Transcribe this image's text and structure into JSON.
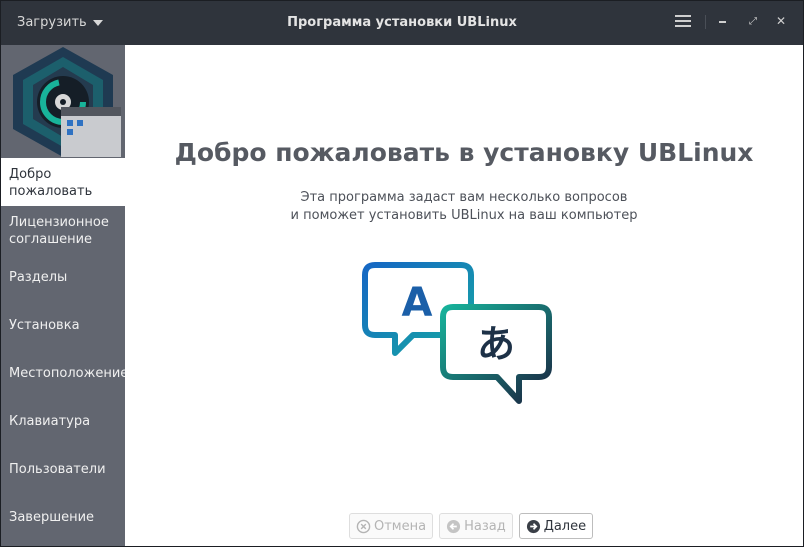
{
  "titlebar": {
    "load_menu": "Загрузить",
    "title": "Программа установки UBLinux",
    "menu_icon": "hamburger-menu-icon",
    "minimize_icon": "minimize-icon",
    "maximize_icon": "maximize-icon",
    "close_icon": "close-icon"
  },
  "sidebar": {
    "logo_icon": "ublinux-installer-logo-icon",
    "items": [
      {
        "label": "Добро пожаловать",
        "active": true
      },
      {
        "label": "Лицензионное соглашение"
      },
      {
        "label": "Разделы"
      },
      {
        "label": "Установка"
      },
      {
        "label": "Местоположение"
      },
      {
        "label": "Клавиатура"
      },
      {
        "label": "Пользователи"
      },
      {
        "label": "Завершение"
      }
    ]
  },
  "main": {
    "heading": "Добро пожаловать в установку UBLinux",
    "subtitle_line1": "Эта программа задаст вам несколько вопросов",
    "subtitle_line2": "и поможет установить UBLinux на ваш компьютер",
    "illustration_icon": "translation-bubbles-icon",
    "glyph_a": "A",
    "glyph_jp": "あ"
  },
  "buttons": {
    "cancel": "Отмена",
    "back": "Назад",
    "next": "Далее"
  },
  "colors": {
    "titlebar": "#2f343c",
    "sidebar": "#626670",
    "accent_blue": "#1a6fbf",
    "accent_teal": "#18b39a",
    "accent_dark": "#1d2b45"
  }
}
